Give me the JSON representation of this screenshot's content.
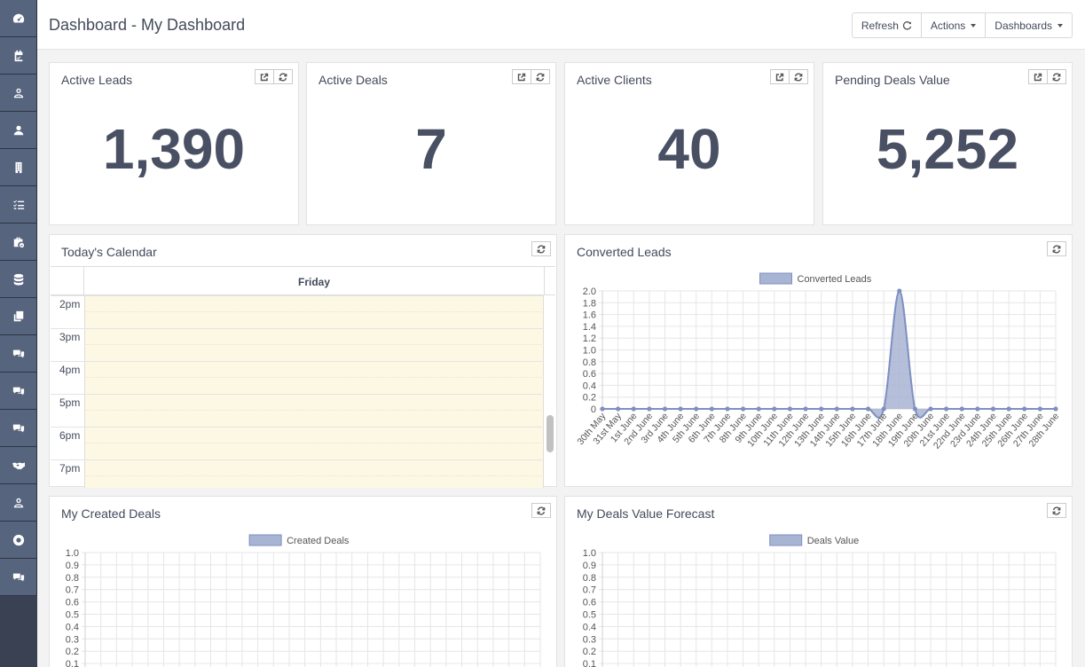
{
  "header": {
    "title": "Dashboard - My Dashboard",
    "buttons": {
      "refresh": "Refresh",
      "actions": "Actions",
      "dashboards": "Dashboards"
    }
  },
  "sidebar": {
    "items": [
      {
        "icon": "dashboard-icon"
      },
      {
        "icon": "calendar-check-icon"
      },
      {
        "icon": "user-outline-icon"
      },
      {
        "icon": "user-icon"
      },
      {
        "icon": "building-icon"
      },
      {
        "icon": "task-list-icon"
      },
      {
        "icon": "briefcase-check-icon"
      },
      {
        "icon": "database-icon"
      },
      {
        "icon": "copy-icon"
      },
      {
        "icon": "chat-icon"
      },
      {
        "icon": "chat-icon"
      },
      {
        "icon": "chat-icon"
      },
      {
        "icon": "handshake-icon"
      },
      {
        "icon": "user-outline-icon"
      },
      {
        "icon": "life-ring-icon"
      },
      {
        "icon": "chat-icon"
      }
    ]
  },
  "kpis": [
    {
      "title": "Active Leads",
      "value": "1,390"
    },
    {
      "title": "Active Deals",
      "value": "7"
    },
    {
      "title": "Active Clients",
      "value": "40"
    },
    {
      "title": "Pending Deals Value",
      "value": "5,252"
    }
  ],
  "calendar": {
    "title": "Today's Calendar",
    "day": "Friday",
    "hours": [
      "2pm",
      "3pm",
      "4pm",
      "5pm",
      "6pm",
      "7pm"
    ]
  },
  "colors": {
    "series_fill": "#a8b4d3",
    "series_stroke": "#7f8fc0",
    "grid": "#e6e6e6"
  },
  "chart_data": [
    {
      "panel_title": "Converted Leads",
      "type": "area",
      "legend": "Converted Leads",
      "categories": [
        "30th May",
        "31st May",
        "1st June",
        "2nd June",
        "3rd June",
        "4th June",
        "5th June",
        "6th June",
        "7th June",
        "8th June",
        "9th June",
        "10th June",
        "11th June",
        "12th June",
        "13th June",
        "14th June",
        "15th June",
        "16th June",
        "17th June",
        "18th June",
        "19th June",
        "20th June",
        "21st June",
        "22nd June",
        "23rd June",
        "24th June",
        "25th June",
        "26th June",
        "27th June",
        "28th June"
      ],
      "values": [
        0,
        0,
        0,
        0,
        0,
        0,
        0,
        0,
        0,
        0,
        0,
        0,
        0,
        0,
        0,
        0,
        0,
        0,
        0,
        2,
        0,
        0,
        0,
        0,
        0,
        0,
        0,
        0,
        0,
        0
      ],
      "ylim": [
        0,
        2.0
      ],
      "yticks": [
        "2.0",
        "1.8",
        "1.6",
        "1.4",
        "1.2",
        "1.0",
        "0.8",
        "0.6",
        "0.4",
        "0.2",
        "0"
      ],
      "grid": true,
      "legend_position": "top"
    },
    {
      "panel_title": "My Created Deals",
      "type": "area",
      "legend": "Created Deals",
      "ylim": [
        0,
        1.0
      ],
      "yticks": [
        "1.0",
        "0.9",
        "0.8",
        "0.7",
        "0.6",
        "0.5",
        "0.4",
        "0.3",
        "0.2",
        "0.1"
      ],
      "grid": true,
      "legend_position": "top"
    },
    {
      "panel_title": "My Deals Value Forecast",
      "type": "area",
      "legend": "Deals Value",
      "ylim": [
        0,
        1.0
      ],
      "yticks": [
        "1.0",
        "0.9",
        "0.8",
        "0.7",
        "0.6",
        "0.5",
        "0.4",
        "0.3",
        "0.2",
        "0.1"
      ],
      "grid": true,
      "legend_position": "top"
    }
  ]
}
